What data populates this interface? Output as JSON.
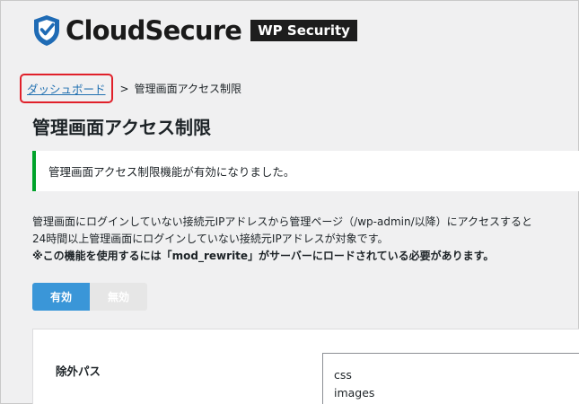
{
  "header": {
    "brand": "CloudSecure",
    "product": "WP Security"
  },
  "breadcrumb": {
    "home": "ダッシュボード",
    "separator": ">",
    "current": "管理画面アクセス制限"
  },
  "page": {
    "title": "管理画面アクセス制限"
  },
  "notice": {
    "message": "管理画面アクセス制限機能が有効になりました。"
  },
  "description": {
    "line1": "管理画面にログインしていない接続元IPアドレスから管理ページ（/wp-admin/以降）にアクセスすると",
    "line2": "24時間以上管理画面にログインしていない接続元IPアドレスが対象です。",
    "line3": "※この機能を使用するには「mod_rewrite」がサーバーにロードされている必要があります。"
  },
  "toggle": {
    "on_label": "有効",
    "off_label": "無効",
    "selected": "有効"
  },
  "settings": {
    "exclude_label": "除外パス",
    "exclude_paths": [
      "css",
      "images"
    ]
  },
  "colors": {
    "link": "#2271b1",
    "highlight": "#e0202a",
    "notice_border": "#00a32a",
    "toggle_on": "#3a96d8",
    "toggle_off": "#e6e6e6"
  },
  "icons": {
    "logo": "shield-check-icon"
  }
}
